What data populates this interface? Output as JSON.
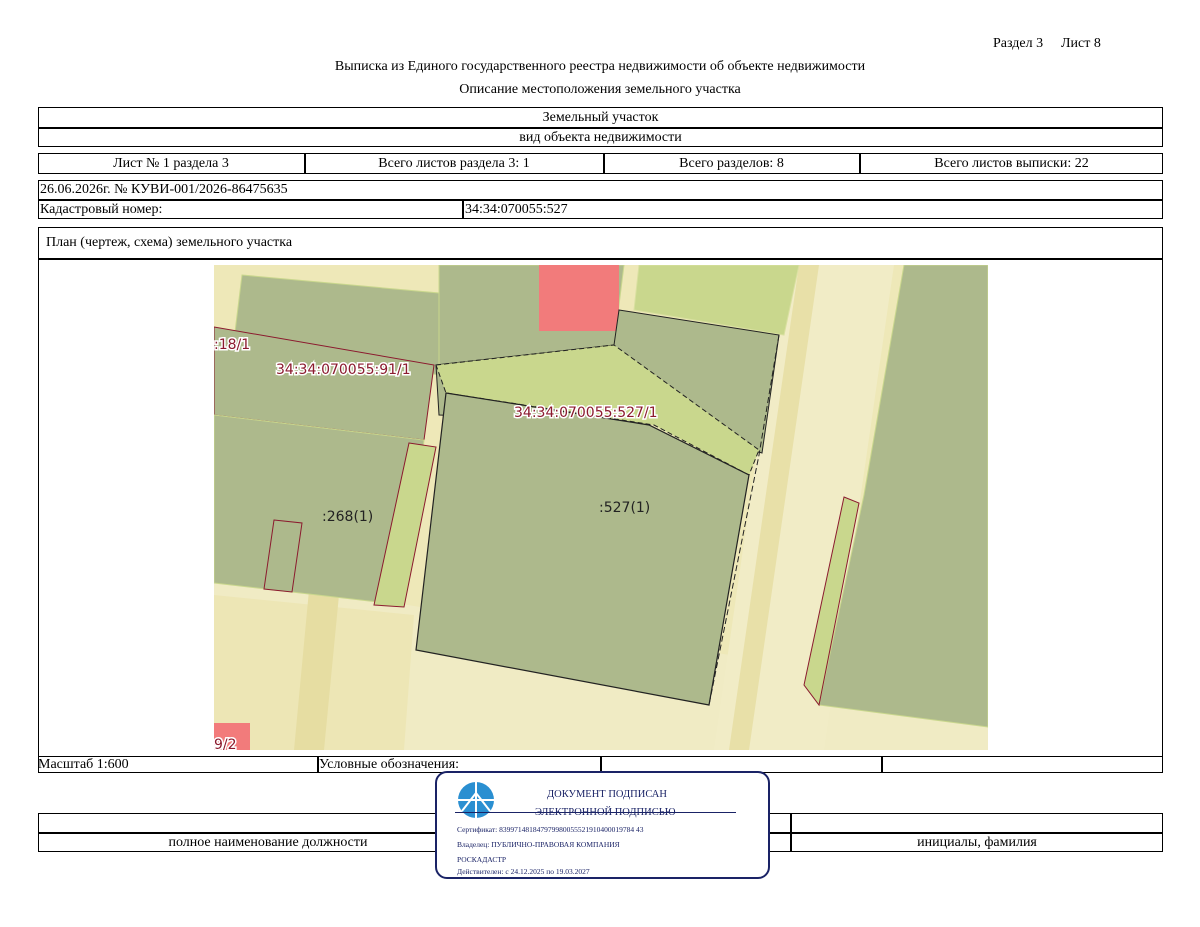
{
  "header": {
    "section": "Раздел 3",
    "sheet": "Лист 8",
    "title": "Выписка из Единого государственного реестра недвижимости об объекте недвижимости",
    "subtitle": "Описание местоположения земельного участка"
  },
  "object": {
    "type": "Земельный участок",
    "type_caption": "вид объекта недвижимости"
  },
  "sheets": {
    "sheet_of_section": "Лист № 1 раздела 3",
    "total_section_sheets": "Всего листов раздела 3: 1",
    "total_sections": "Всего разделов: 8",
    "total_extract_sheets": "Всего листов выписки: 22"
  },
  "record": {
    "date_number": "26.06.2026г. № КУВИ-001/2026-86475635",
    "cadastral_label": "Кадастровый номер:",
    "cadastral_value": "34:34:070055:527"
  },
  "plan": {
    "title": "План (чертеж, схема) земельного участка",
    "labels": {
      "parcel_18": ":18/1",
      "parcel_91": "34:34:070055:91/1",
      "parcel_527_1": "34:34:070055:527/1",
      "parcel_268": ":268(1)",
      "parcel_527": ":527(1)",
      "parcel_bottom": "9/2"
    }
  },
  "footer": {
    "scale": "Масштаб 1:600",
    "legend": "Условные обозначения:",
    "position_caption": "полное наименование должности",
    "name_caption": "инициалы, фамилия"
  },
  "stamp": {
    "line1": "ДОКУМЕНТ ПОДПИСАН",
    "line2": "ЭЛЕКТРОННОЙ ПОДПИСЬЮ",
    "certificate": "Сертификат: 839971481847979980055521910400019784 43",
    "owner": "Владелец: ПУБЛИЧНО-ПРАВОВАЯ КОМПАНИЯ",
    "owner2": "РОСКАДАСТР",
    "valid": "Действителен: с 24.12.2025 по 19.03.2027"
  },
  "colors": {
    "parcel_fill": "#adb98c",
    "strip_fill": "#c9d78d",
    "road_fill": "#eee8b8",
    "building_fill": "#f27b7b",
    "boundary": "#8b1a2e",
    "stamp_blue": "#1a2366",
    "logo_blue": "#2a8fd1"
  }
}
